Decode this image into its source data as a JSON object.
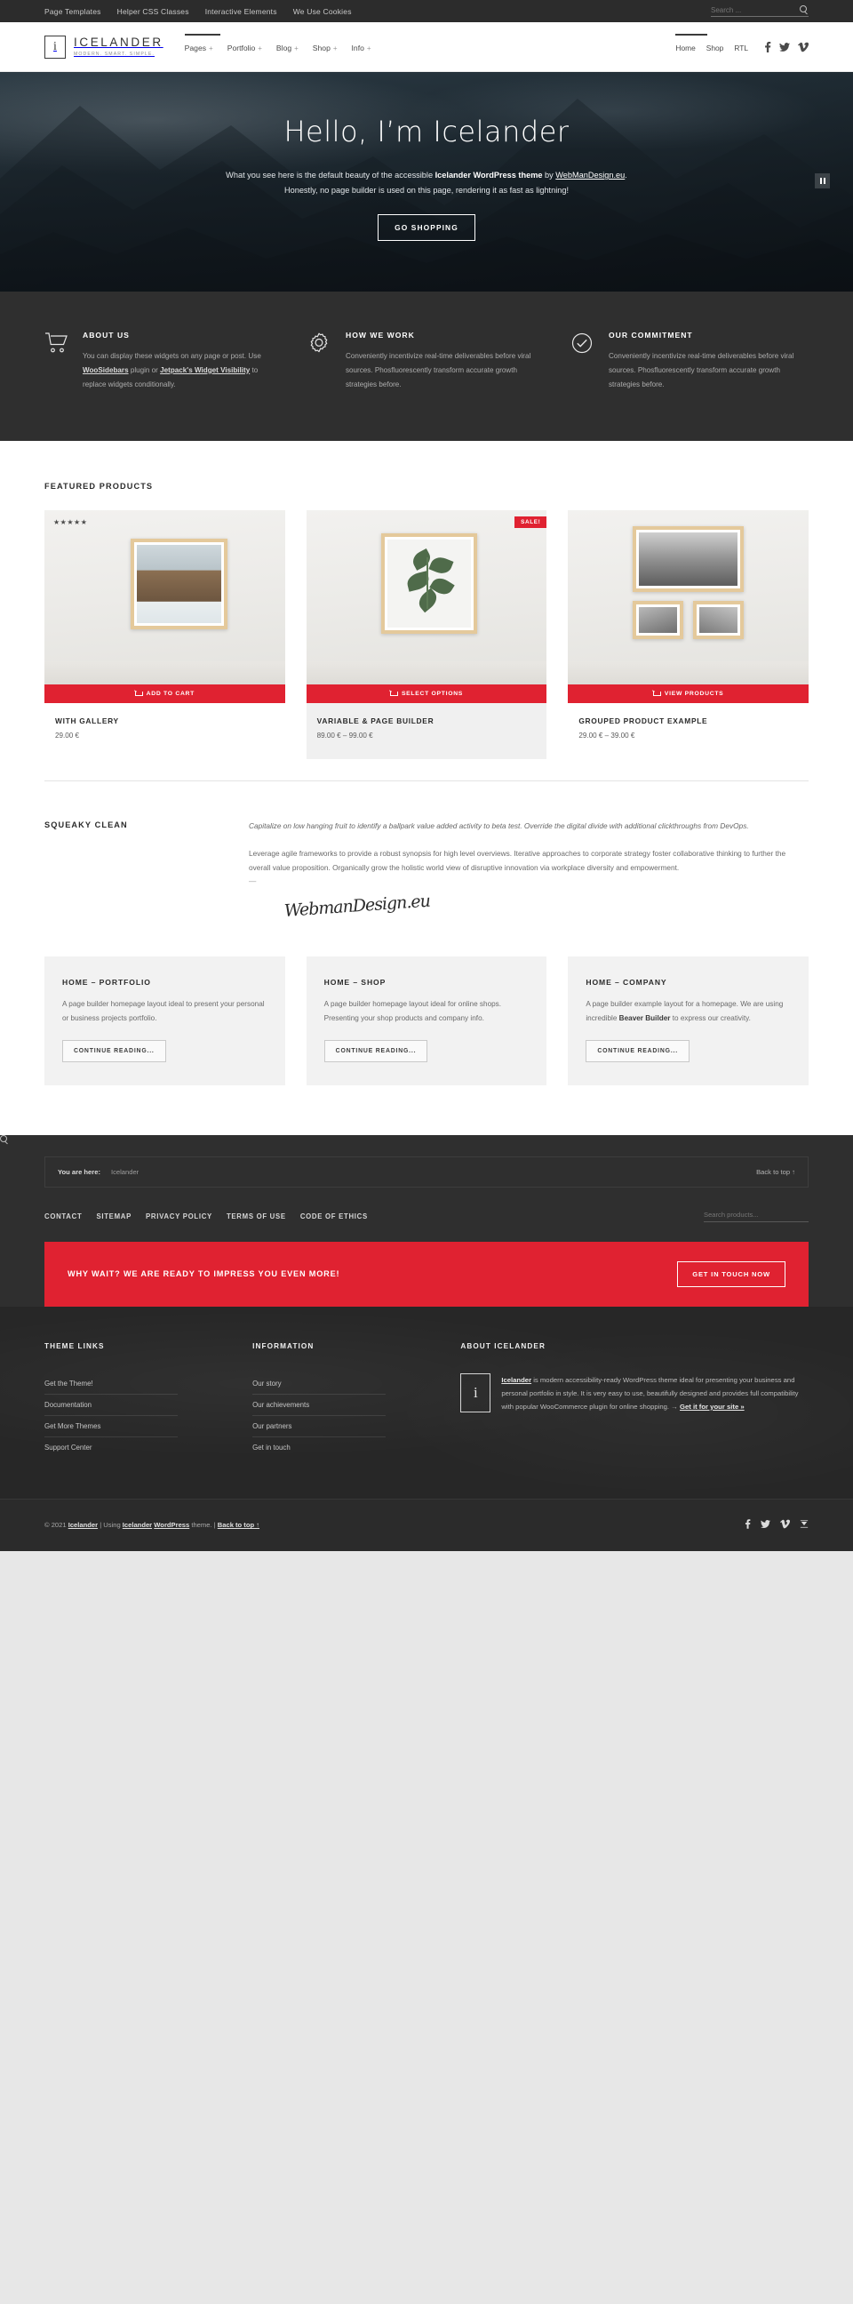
{
  "topbar": {
    "links": [
      "Page Templates",
      "Helper CSS Classes",
      "Interactive Elements",
      "We Use Cookies"
    ],
    "search_placeholder": "Search ...",
    "search_value": ""
  },
  "header": {
    "brand_letter": "i",
    "brand_title": "ICELANDER",
    "brand_tagline": "MODERN. SMART. SIMPLE.",
    "main_nav": [
      {
        "label": "Pages",
        "plus": "+"
      },
      {
        "label": "Portfolio",
        "plus": "+"
      },
      {
        "label": "Blog",
        "plus": "+"
      },
      {
        "label": "Shop",
        "plus": "+"
      },
      {
        "label": "Info",
        "plus": "+"
      }
    ],
    "secondary_nav": [
      "Home",
      "Shop",
      "RTL"
    ],
    "socials": [
      "facebook-icon",
      "twitter-icon",
      "vimeo-icon"
    ]
  },
  "hero": {
    "heading": "Hello, I’m Icelander",
    "paragraph_1": "What you see here is the default beauty of the accessible ",
    "paragraph_bold_1": "Icelander WordPress theme",
    "paragraph_2": " by ",
    "paragraph_link": "WebManDesign.eu",
    "paragraph_3": ". Honestly, no page builder is used on this page, rendering it as fast as lightning!",
    "button": "GO SHOPPING",
    "pause_label": "pause-slider"
  },
  "widgets": [
    {
      "icon": "cart-icon",
      "title": "ABOUT US",
      "text_1": "You can display these widgets on any page or post. Use ",
      "link_1": "WooSidebars",
      "text_2": " plugin or ",
      "link_2": "Jetpack's Widget Visibility",
      "text_3": " to replace widgets conditionally."
    },
    {
      "icon": "gear-icon",
      "title": "HOW WE WORK",
      "text_1": "Conveniently incentivize real-time deliverables before viral sources. Phosfluorescently transform accurate growth strategies before.",
      "link_1": "",
      "text_2": "",
      "link_2": "",
      "text_3": ""
    },
    {
      "icon": "check-circle-icon",
      "title": "OUR COMMITMENT",
      "text_1": "Conveniently incentivize real-time deliverables before viral sources. Phosfluorescently transform accurate growth strategies before.",
      "link_1": "",
      "text_2": "",
      "link_2": "",
      "text_3": ""
    }
  ],
  "products_section": {
    "title": "FEATURED PRODUCTS",
    "items": [
      {
        "badge": "",
        "stars": "★★★★★",
        "button": "ADD TO CART",
        "name": "WITH GALLERY",
        "price": "29.00 €",
        "highlighted": false
      },
      {
        "badge": "SALE!",
        "stars": "",
        "button": "SELECT OPTIONS",
        "name": "VARIABLE & PAGE BUILDER",
        "price": "89.00 € – 99.00 €",
        "highlighted": true
      },
      {
        "badge": "",
        "stars": "",
        "button": "VIEW PRODUCTS",
        "name": "GROUPED PRODUCT EXAMPLE",
        "price": "29.00 € – 39.00 €",
        "highlighted": false
      }
    ]
  },
  "squeaky": {
    "title": "SQUEAKY CLEAN",
    "lead": "Capitalize on low hanging fruit to identify a ballpark value added activity to beta test. Override the digital divide with additional clickthroughs from DevOps.",
    "body": "Leverage agile frameworks to provide a robust synopsis for high level overviews. Iterative approaches to corporate strategy foster collaborative thinking to further the overall value proposition. Organically grow the holistic world view of disruptive innovation via workplace diversity and empowerment.",
    "dash": "—",
    "signature": "WebmanDesign.eu"
  },
  "cards": [
    {
      "title": "HOME – PORTFOLIO",
      "body": "A page builder homepage layout ideal to present your personal or business projects portfolio.",
      "bold": "",
      "body_after": "",
      "button": "CONTINUE READING..."
    },
    {
      "title": "HOME – SHOP",
      "body": "A page builder homepage layout ideal for online shops. Presenting your shop products and company info.",
      "bold": "",
      "body_after": "",
      "button": "CONTINUE READING..."
    },
    {
      "title": "HOME – COMPANY",
      "body": "A page builder example layout for a homepage. We are using incredible ",
      "bold": "Beaver Builder",
      "body_after": " to express our creativity.",
      "button": "CONTINUE READING..."
    }
  ],
  "footer": {
    "breadcrumb_label": "You are here:",
    "breadcrumb_item": "Icelander",
    "back_to_top": "Back to top ↑",
    "links": [
      "CONTACT",
      "SITEMAP",
      "PRIVACY POLICY",
      "TERMS OF USE",
      "CODE OF ETHICS"
    ],
    "search_placeholder": "Search products...",
    "search_value": "",
    "cta_text": "WHY WAIT? WE ARE READY TO IMPRESS YOU EVEN MORE!",
    "cta_button": "GET IN TOUCH NOW",
    "columns": [
      {
        "title": "THEME LINKS",
        "items": [
          "Get the Theme!",
          "Documentation",
          "Get More Themes",
          "Support Center"
        ]
      },
      {
        "title": "INFORMATION",
        "items": [
          "Our story",
          "Our achievements",
          "Our partners",
          "Get in touch"
        ]
      }
    ],
    "about": {
      "title": "ABOUT ICELANDER",
      "mark": "i",
      "link_name": "Icelander",
      "text": " is modern accessibility-ready WordPress theme ideal for presenting your business and personal portfolio in style. It is very easy to use, beautifully designed and provides full compatibility with popular WooCommerce plugin for online shopping. → ",
      "cta_link": "Get it for your site »"
    },
    "copyright_pre": "© 2021 ",
    "copyright_link1": "Icelander",
    "copyright_mid": " | Using ",
    "copyright_link2": "Icelander",
    "copyright_mid2": " ",
    "copyright_link3": "WordPress",
    "copyright_post": " theme. | ",
    "copyright_top": "Back to top ↑",
    "socials": [
      "facebook-icon",
      "twitter-icon",
      "vimeo-icon",
      "top-icon"
    ]
  }
}
